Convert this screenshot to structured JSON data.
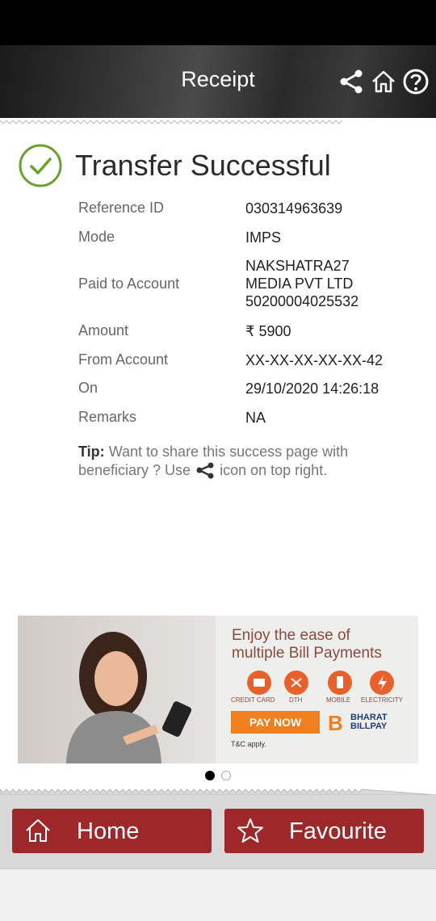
{
  "header": {
    "title": "Receipt",
    "icons": [
      "share-icon",
      "home-icon",
      "help-icon"
    ]
  },
  "status": {
    "title": "Transfer Successful",
    "icon": "check-circle-icon",
    "color": "#6aa12a"
  },
  "details": [
    {
      "label": "Reference ID",
      "value": "030314963639"
    },
    {
      "label": "Mode",
      "value": "IMPS"
    },
    {
      "label": "Paid to Account",
      "value_lines": [
        "NAKSHATRA27",
        "MEDIA PVT LTD",
        "50200004025532"
      ]
    },
    {
      "label": "Amount",
      "value": "₹ 5900"
    },
    {
      "label": "From Account",
      "value": "XX-XX-XX-XX-XX-42"
    },
    {
      "label": "On",
      "value": "29/10/2020 14:26:18"
    },
    {
      "label": "Remarks",
      "value": "NA"
    }
  ],
  "tip": {
    "label": "Tip:",
    "text_before": "Want to share this success page with beneficiary ? Use",
    "text_after": "icon on top right."
  },
  "banner": {
    "headline_1": "Enjoy the ease of",
    "headline_2": "multiple Bill Payments",
    "categories": [
      "CREDIT CARD",
      "DTH",
      "MOBILE",
      "ELECTRICITY"
    ],
    "cta": "PAY NOW",
    "brand_mark": "B",
    "brand_1": "BHARAT",
    "brand_2": "BILLPAY",
    "terms": "T&C apply."
  },
  "carousel": {
    "active_index": 0,
    "count": 2
  },
  "footer": {
    "home_label": "Home",
    "favourite_label": "Favourite",
    "button_color": "#9e2729"
  }
}
